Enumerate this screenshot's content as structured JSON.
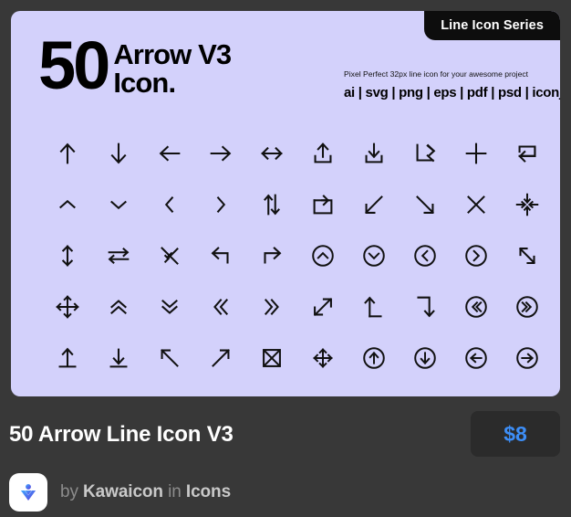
{
  "card": {
    "badge_label": "Line Icon Series",
    "count": "50",
    "title_line1": "Arrow V3",
    "title_line2": "Icon.",
    "tagline": "Pixel Perfect 32px line icon for your awesome project",
    "formats": "ai | svg | png | eps | pdf | psd | iconjar",
    "background_color": "#d3d1fb",
    "badge_background": "#0d0d0d",
    "text_color": "#000000"
  },
  "icons": [
    {
      "name": "arrow-up-icon"
    },
    {
      "name": "arrow-down-icon"
    },
    {
      "name": "arrow-left-icon"
    },
    {
      "name": "arrow-right-icon"
    },
    {
      "name": "arrow-left-right-icon"
    },
    {
      "name": "upload-icon"
    },
    {
      "name": "download-icon"
    },
    {
      "name": "arrow-turn-up-right-icon"
    },
    {
      "name": "plus-icon"
    },
    {
      "name": "repeat-icon"
    },
    {
      "name": "chevron-up-icon"
    },
    {
      "name": "chevron-down-icon"
    },
    {
      "name": "chevron-left-icon"
    },
    {
      "name": "chevron-right-icon"
    },
    {
      "name": "arrows-up-down-swap-icon"
    },
    {
      "name": "redo-box-icon"
    },
    {
      "name": "arrow-diagonal-down-left-icon"
    },
    {
      "name": "arrow-diagonal-down-right-icon"
    },
    {
      "name": "close-x-icon"
    },
    {
      "name": "collapse-center-icon"
    },
    {
      "name": "arrow-up-down-icon"
    },
    {
      "name": "arrows-swap-horizontal-icon"
    },
    {
      "name": "merge-diagonal-icon"
    },
    {
      "name": "undo-arrow-icon"
    },
    {
      "name": "redo-arrow-icon"
    },
    {
      "name": "circle-chevron-up-icon"
    },
    {
      "name": "circle-chevron-down-icon"
    },
    {
      "name": "circle-chevron-left-icon"
    },
    {
      "name": "circle-chevron-right-icon"
    },
    {
      "name": "arrow-diagonal-up-left-down-right-icon"
    },
    {
      "name": "move-four-way-icon"
    },
    {
      "name": "double-chevron-up-icon"
    },
    {
      "name": "double-chevron-down-icon"
    },
    {
      "name": "double-chevron-left-icon"
    },
    {
      "name": "double-chevron-right-icon"
    },
    {
      "name": "expand-diagonal-icon"
    },
    {
      "name": "arrow-turn-up-left-icon"
    },
    {
      "name": "arrow-turn-down-right-icon"
    },
    {
      "name": "circle-double-chevron-left-icon"
    },
    {
      "name": "circle-double-chevron-right-icon"
    },
    {
      "name": "arrow-up-to-line-icon"
    },
    {
      "name": "arrow-down-to-line-icon"
    },
    {
      "name": "arrow-diagonal-up-left-icon"
    },
    {
      "name": "arrow-diagonal-up-right-icon"
    },
    {
      "name": "expand-box-icon"
    },
    {
      "name": "move-arrows-icon"
    },
    {
      "name": "circle-arrow-up-icon"
    },
    {
      "name": "circle-arrow-down-icon"
    },
    {
      "name": "circle-arrow-left-icon"
    },
    {
      "name": "circle-arrow-right-icon"
    }
  ],
  "footer": {
    "product_title": "50 Arrow Line Icon V3",
    "price": "$8",
    "price_color": "#3d8ef7",
    "byline_prefix": "by ",
    "author": "Kawaicon",
    "byline_middle": " in ",
    "category": "Icons",
    "avatar_name": "kawaicon-logo"
  }
}
